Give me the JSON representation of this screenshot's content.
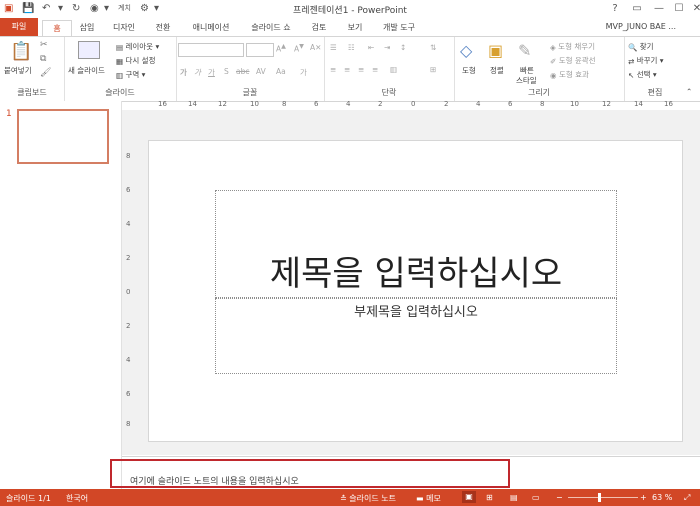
{
  "window": {
    "title": "프레젠테이션1 - PowerPoint",
    "account": "MVP_JUNO BAE ...",
    "help": "?",
    "restore_ribbon": "▭",
    "minimize": "—",
    "maximize": "☐",
    "close": "✕"
  },
  "qat": {
    "typed_text": "계치"
  },
  "tabs": [
    "파일",
    "홈",
    "삽입",
    "디자인",
    "전환",
    "애니메이션",
    "슬라이드 쇼",
    "검토",
    "보기",
    "개발 도구"
  ],
  "ribbon": {
    "clipboard": {
      "label": "클립보드",
      "paste": "붙여넣기"
    },
    "slides": {
      "label": "슬라이드",
      "new_slide": "새 슬라이드",
      "layout": "레이아웃",
      "reset": "다시 설정",
      "section": "구역"
    },
    "font": {
      "label": "글꼴",
      "font_name": "",
      "font_size": "",
      "bold": "가",
      "italic": "가",
      "underline": "가",
      "strike": "abc",
      "shadow": "S",
      "spacing": "AV",
      "case": "Aa",
      "color": "가"
    },
    "paragraph": {
      "label": "단락"
    },
    "drawing": {
      "label": "그리기",
      "shapes": "도형",
      "arrange": "정렬",
      "quick_styles_1": "빠른",
      "quick_styles_2": "스타일",
      "fill": "도형 채우기",
      "outline": "도형 윤곽선",
      "effects": "도형 효과"
    },
    "editing": {
      "label": "편집",
      "find": "찾기",
      "replace": "바꾸기",
      "select": "선택"
    }
  },
  "ruler_h": [
    "16",
    "14",
    "12",
    "10",
    "8",
    "6",
    "4",
    "2",
    "0",
    "2",
    "4",
    "6",
    "8",
    "10",
    "12",
    "14",
    "16"
  ],
  "ruler_v": [
    "8",
    "6",
    "4",
    "2",
    "0",
    "2",
    "4",
    "6",
    "8"
  ],
  "thumbnails": {
    "number": "1"
  },
  "slide": {
    "title_placeholder": "제목을 입력하십시오",
    "subtitle_placeholder": "부제목을 입력하십시오"
  },
  "notes": {
    "placeholder": "여기에 슬라이드 노트의 내용을 입력하십시오"
  },
  "status": {
    "slide_count": "슬라이드 1/1",
    "language": "한국어",
    "notes_button": "슬라이드 노트",
    "comments_button": "메모",
    "zoom": "63 %"
  },
  "colors": {
    "accent": "#d24726",
    "highlight": "#c0282d"
  }
}
